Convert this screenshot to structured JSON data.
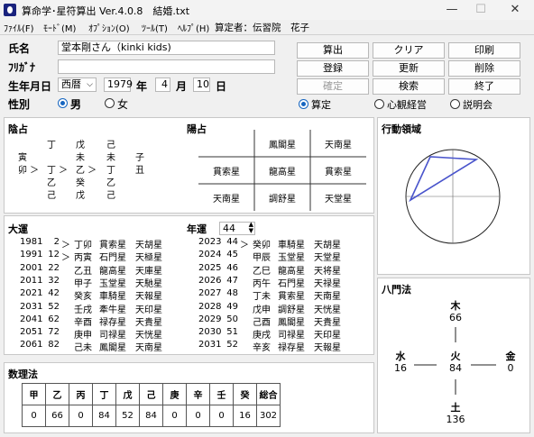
{
  "window": {
    "title": "算命学･星符算出 Ver.4.0.8　結婚.txt",
    "min": "—",
    "max": "☐",
    "close": "✕"
  },
  "menu": [
    "ﾌｧｲﾙ(F)",
    "ﾓｰﾄﾞ(M)",
    "ｵﾌﾟｼｮﾝ(O)",
    "ﾂｰﾙ(T)",
    "ﾍﾙﾌﾟ(H)"
  ],
  "calculator": "算定者：伝習院　花子",
  "form": {
    "name_label": "氏名",
    "name_value": "堂本剛さん（kinki kids)",
    "kana_label": "ﾌﾘｶﾞﾅ",
    "kana_value": "",
    "birth_label": "生年月日",
    "era": "西暦",
    "year": "1979",
    "year_unit": "年",
    "month": "4",
    "month_unit": "月",
    "day": "10",
    "day_unit": "日",
    "gender_label": "性別",
    "male": "男",
    "female": "女",
    "gender_selected": "男"
  },
  "buttons": {
    "calc": "算出",
    "clear": "クリア",
    "print": "印刷",
    "register": "登録",
    "update": "更新",
    "delete": "削除",
    "confirm": "確定",
    "search": "検索",
    "exit": "終了"
  },
  "modes": {
    "santei": "算定",
    "shinkan": "心観経営",
    "setsumei": "説明会",
    "selected": "算定"
  },
  "inyo": {
    "title": "陰占",
    "rows": [
      [
        "",
        "丁",
        "戊",
        "己",
        ""
      ],
      [
        "寅",
        "",
        "未",
        "未",
        "子"
      ],
      [
        "卯 ＞",
        "丁 ＞",
        "乙 ＞",
        "丁",
        "丑"
      ],
      [
        "",
        "乙",
        "癸",
        "乙",
        ""
      ],
      [
        "",
        "己",
        "戊",
        "己",
        ""
      ]
    ]
  },
  "yosen": {
    "title": "陽占",
    "grid": [
      [
        "",
        "鳳閣星",
        "天南星"
      ],
      [
        "貫索星",
        "龍高星",
        "貫索星"
      ],
      [
        "天南星",
        "調舒星",
        "天堂星"
      ]
    ]
  },
  "area": {
    "title": "行動領域"
  },
  "taiun": {
    "title": "大運",
    "rows": [
      [
        "1981",
        "2",
        "＞",
        "丁卯",
        "貫索星",
        "天胡星"
      ],
      [
        "1991",
        "12",
        "＞",
        "丙寅",
        "石門星",
        "天極星"
      ],
      [
        "2001",
        "22",
        "",
        "乙丑",
        "龍高星",
        "天庫星"
      ],
      [
        "2011",
        "32",
        "",
        "甲子",
        "玉堂星",
        "天馳星"
      ],
      [
        "2021",
        "42",
        "",
        "癸亥",
        "車騎星",
        "天報星"
      ],
      [
        "2031",
        "52",
        "",
        "壬戌",
        "牽牛星",
        "天印星"
      ],
      [
        "2041",
        "62",
        "",
        "辛酉",
        "禄存星",
        "天貴星"
      ],
      [
        "2051",
        "72",
        "",
        "庚申",
        "司禄星",
        "天恍星"
      ],
      [
        "2061",
        "82",
        "",
        "己未",
        "鳳閣星",
        "天南星"
      ]
    ]
  },
  "nenun": {
    "title": "年運",
    "age": "44",
    "rows": [
      [
        "2023",
        "44",
        "＞",
        "癸卯",
        "車騎星",
        "天胡星"
      ],
      [
        "2024",
        "45",
        "",
        "甲辰",
        "玉堂星",
        "天堂星"
      ],
      [
        "2025",
        "46",
        "",
        "乙巳",
        "龍高星",
        "天将星"
      ],
      [
        "2026",
        "47",
        "",
        "丙午",
        "石門星",
        "天禄星"
      ],
      [
        "2027",
        "48",
        "",
        "丁未",
        "貫索星",
        "天南星"
      ],
      [
        "2028",
        "49",
        "",
        "戊申",
        "調舒星",
        "天恍星"
      ],
      [
        "2029",
        "50",
        "",
        "己酉",
        "鳳閣星",
        "天貴星"
      ],
      [
        "2030",
        "51",
        "",
        "庚戌",
        "司禄星",
        "天印星"
      ],
      [
        "2031",
        "52",
        "",
        "辛亥",
        "禄存星",
        "天報星"
      ]
    ]
  },
  "suuri": {
    "title": "数理法",
    "headers": [
      "甲",
      "乙",
      "丙",
      "丁",
      "戊",
      "己",
      "庚",
      "辛",
      "壬",
      "癸",
      "総合"
    ],
    "values": [
      "0",
      "66",
      "0",
      "84",
      "52",
      "84",
      "0",
      "0",
      "0",
      "16",
      "302"
    ]
  },
  "hachimon": {
    "title": "八門法",
    "wood": {
      "label": "木",
      "value": "66"
    },
    "fire": {
      "label": "火",
      "value": "84"
    },
    "water": {
      "label": "水",
      "value": "16"
    },
    "metal": {
      "label": "金",
      "value": "0"
    },
    "earth": {
      "label": "土",
      "value": "136"
    }
  }
}
